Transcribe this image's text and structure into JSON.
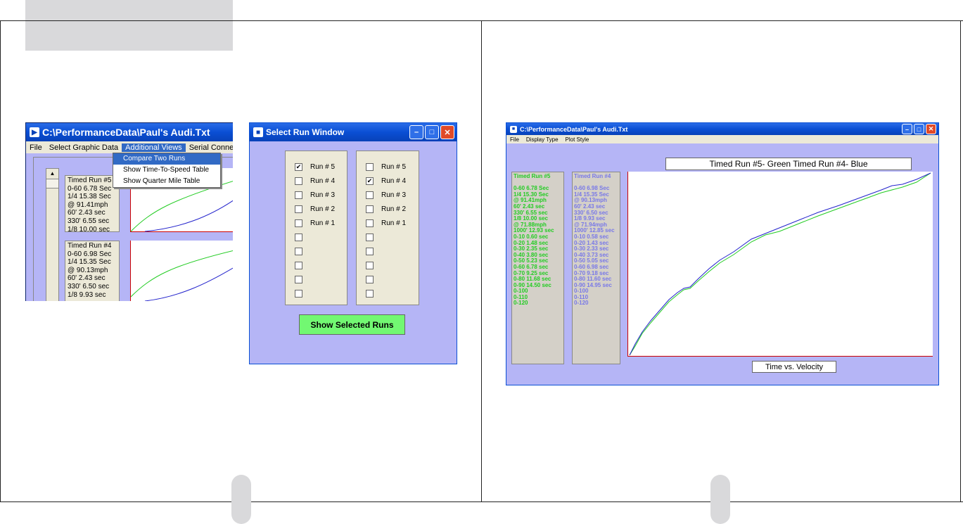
{
  "win1": {
    "title": "C:\\PerformanceData\\Paul's Audi.Txt",
    "menu": [
      "File",
      "Select Graphic Data",
      "Additional Views",
      "Serial Connection"
    ],
    "dropdown": [
      "Compare Two Runs",
      "Show Time-To-Speed Table",
      "Show Quarter Mile Table"
    ],
    "run5": [
      "Timed Run #5",
      "0-60 6.78 Sec",
      "1/4 15.38 Sec",
      "@ 91.41mph",
      "60' 2.43 sec",
      "330' 6.55 sec",
      "1/8 10.00 sec"
    ],
    "run4": [
      "Timed Run #4",
      "0-60 6.98 Sec",
      "1/4 15.35 Sec",
      "@ 90.13mph",
      "60' 2.43 sec",
      "330' 6.50 sec",
      "1/8 9.93 sec"
    ]
  },
  "win2": {
    "title": "Select Run Window",
    "left_runs": [
      {
        "label": "Run # 5",
        "checked": true
      },
      {
        "label": "Run # 4",
        "checked": false
      },
      {
        "label": "Run # 3",
        "checked": false
      },
      {
        "label": "Run # 2",
        "checked": false
      },
      {
        "label": "Run # 1",
        "checked": false
      },
      {
        "label": "",
        "checked": false
      },
      {
        "label": "",
        "checked": false
      },
      {
        "label": "",
        "checked": false
      },
      {
        "label": "",
        "checked": false
      },
      {
        "label": "",
        "checked": false
      }
    ],
    "right_runs": [
      {
        "label": "Run # 5",
        "checked": false
      },
      {
        "label": "Run # 4",
        "checked": true
      },
      {
        "label": "Run # 3",
        "checked": false
      },
      {
        "label": "Run # 2",
        "checked": false
      },
      {
        "label": "Run # 1",
        "checked": false
      },
      {
        "label": "",
        "checked": false
      },
      {
        "label": "",
        "checked": false
      },
      {
        "label": "",
        "checked": false
      },
      {
        "label": "",
        "checked": false
      },
      {
        "label": "",
        "checked": false
      }
    ],
    "button": "Show Selected Runs"
  },
  "win3": {
    "title": "C:\\PerformanceData\\Paul's Audi.Txt",
    "menu": [
      "File",
      "Display Type",
      "Plot Style"
    ],
    "legend": "Timed Run #5- Green    Timed Run #4- Blue",
    "xcaption": "Time vs. Velocity",
    "run5": [
      "Timed Run #5",
      "",
      "0-60 6.78 Sec",
      "1/4 15.30 Sec",
      "@ 91.41mph",
      "60' 2.43 sec",
      "330' 6.55 sec",
      "1/8 10.00 sec",
      "@ 71.88mph",
      "1000' 12.93 sec",
      "0-10 0.60 sec",
      "0-20 1.48 sec",
      "0-30 2.35 sec",
      "0-40 3.80 sec",
      "0-50 5.23 sec",
      "0-60 6.78 sec",
      "0-70 9.25 sec",
      "0-80 11.68 sec",
      "0-90 14.50 sec",
      "0-100",
      "0-110",
      "0-120"
    ],
    "run4": [
      "Timed Run #4",
      "",
      "0-60 6.98 Sec",
      "1/4 15.35 Sec",
      "@ 90.13mph",
      "60' 2.43 sec",
      "330' 6.50 sec",
      "1/8 9.93 sec",
      "@ 71.94mph",
      "1000' 12.85 sec",
      "0-10 0.58 sec",
      "0-20 1.43 sec",
      "0-30 2.33 sec",
      "0-40 3.73 sec",
      "0-50 5.05 sec",
      "0-60 6.98 sec",
      "0-70 9.18 sec",
      "0-80 11.60 sec",
      "0-90 14.95 sec",
      "0-100",
      "0-110",
      "0-120"
    ],
    "colors": {
      "run5": "#22cc22",
      "run4": "#2222cc"
    }
  }
}
